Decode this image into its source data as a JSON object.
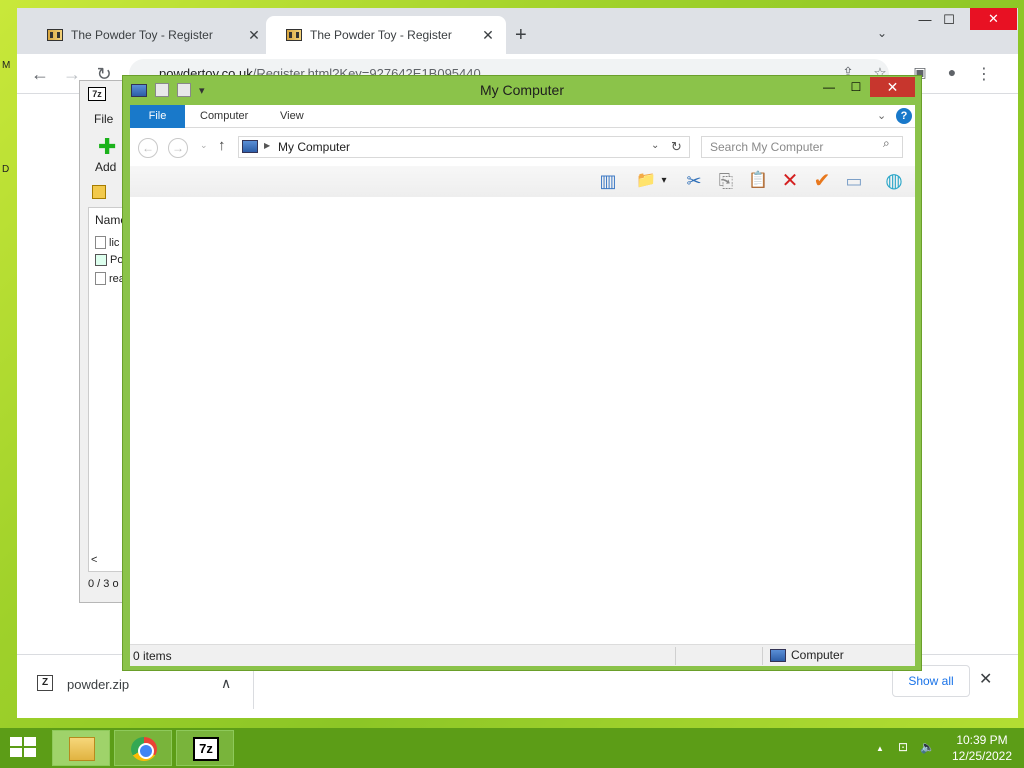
{
  "desktop": {
    "edge_label_top": "M",
    "edge_label_mid": "D"
  },
  "browser": {
    "tabs": [
      {
        "title": "The Powder Toy - Register",
        "close": "✕"
      },
      {
        "title": "The Powder Toy - Register",
        "close": "✕"
      }
    ],
    "new_tab": "+",
    "tab_menu": "⌄",
    "window_controls": {
      "minimize": "—",
      "maximize": "☐",
      "close": "✕"
    },
    "nav": {
      "back": "←",
      "forward": "→",
      "reload": "↻"
    },
    "url": {
      "host": "powdertoy.co.uk",
      "path": "/Register.html?Key=927642E1B095440"
    },
    "toolbar_icons": {
      "share": "⇪",
      "bookmark": "☆",
      "sidebar": "▣",
      "profile": "●",
      "menu": "⋮"
    },
    "downloads": {
      "file_name": "powder.zip",
      "file_icon": "Z",
      "chevron": "∧",
      "show_all": "Show all",
      "close": "✕"
    }
  },
  "sevenzip": {
    "logo": "7z",
    "menu_file": "File",
    "add_label": "Add",
    "add_icon": "✚",
    "column_name": "Name",
    "rows": [
      "lic",
      "Po",
      "rea"
    ],
    "status": "0 / 3 o",
    "scroll_left": "<"
  },
  "explorer": {
    "title": "My Computer",
    "window_controls": {
      "minimize": "—",
      "maximize": "☐",
      "close": "✕"
    },
    "ribbon_tabs": {
      "file": "File",
      "computer": "Computer",
      "view": "View"
    },
    "ribbon_chevron": "⌄",
    "help": "?",
    "address": {
      "back": "←",
      "forward": "→",
      "dropdown": "⌄",
      "up": "↑",
      "arrow": "▶",
      "path": "My Computer",
      "chevron": "⌄",
      "refresh": "↻"
    },
    "search_placeholder": "Search My Computer",
    "search_icon": "⌕",
    "command_icons": {
      "layout": "▥",
      "folder_options": "📁",
      "options_dropdown": "▾",
      "cut": "✂",
      "copy": "⎘",
      "paste": "📋",
      "delete": "✕",
      "properties": "✔",
      "rename": "▭",
      "network": "◍"
    },
    "status": {
      "items": "0 items",
      "location": "Computer"
    }
  },
  "taskbar": {
    "apps": [
      "file-explorer",
      "chrome",
      "7-zip"
    ],
    "sz_label": "7z",
    "tray": {
      "up": "▲",
      "network": "⊡",
      "volume": "🔈"
    },
    "time": "10:39 PM",
    "date": "12/25/2022"
  },
  "colors": {
    "explorer_frame": "#8bc34a",
    "ribbon_file": "#1979ca",
    "close_red": "#c7362d",
    "taskbar": "#5c9d17",
    "link_blue": "#1a73e8"
  }
}
